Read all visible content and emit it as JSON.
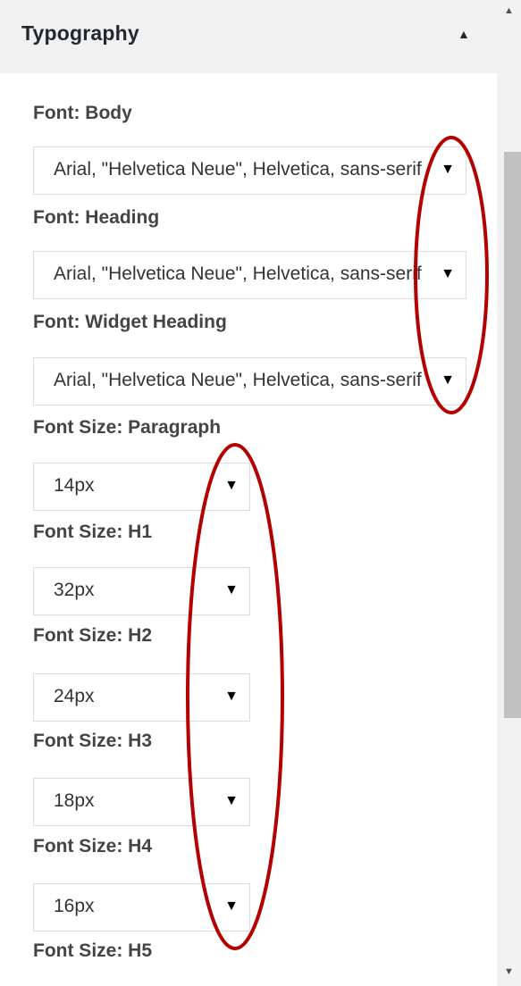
{
  "section": {
    "title": "Typography",
    "toggle_icon": "collapse-up-icon"
  },
  "fields": {
    "font_body": {
      "label": "Font: Body",
      "value": "Arial, \"Helvetica Neue\", Helvetica, sans-serif"
    },
    "font_heading": {
      "label": "Font: Heading",
      "value": "Arial, \"Helvetica Neue\", Helvetica, sans-serif"
    },
    "font_widget_heading": {
      "label": "Font: Widget Heading",
      "value": "Arial, \"Helvetica Neue\", Helvetica, sans-serif"
    },
    "size_paragraph": {
      "label": "Font Size: Paragraph",
      "value": "14px"
    },
    "size_h1": {
      "label": "Font Size: H1",
      "value": "32px"
    },
    "size_h2": {
      "label": "Font Size: H2",
      "value": "24px"
    },
    "size_h3": {
      "label": "Font Size: H3",
      "value": "18px"
    },
    "size_h4": {
      "label": "Font Size: H4",
      "value": "16px"
    },
    "size_h5": {
      "label": "Font Size: H5"
    }
  },
  "glyphs": {
    "dropdown_arrow": "▼",
    "collapse_arrow": "▲",
    "scroll_up": "▲",
    "scroll_down": "▼"
  },
  "colors": {
    "annotation_ring": "#b30000",
    "header_bg": "#f1f1f1",
    "scrollbar_thumb": "#c1c1c1"
  }
}
